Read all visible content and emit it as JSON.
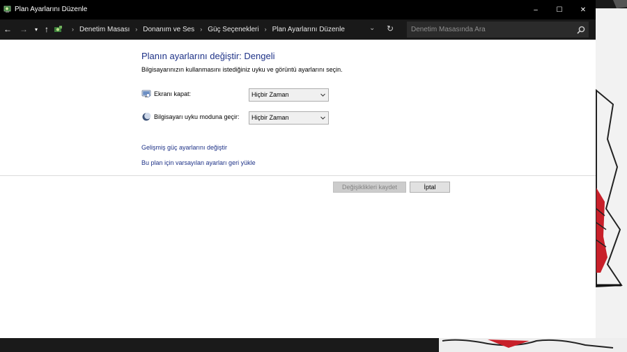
{
  "window": {
    "title": "Plan Ayarlarını Düzenle",
    "controls": {
      "minimize": "–",
      "maximize": "☐",
      "close": "✕"
    }
  },
  "addressbar": {
    "breadcrumbs": [
      "Denetim Masası",
      "Donanım ve Ses",
      "Güç Seçenekleri",
      "Plan Ayarlarını Düzenle"
    ],
    "search_placeholder": "Denetim Masasında Ara"
  },
  "content": {
    "heading": "Planın ayarlarını değiştir: Dengeli",
    "subheading": "Bilgisayarınızın kullanmasını istediğiniz uyku ve görüntü ayarlarını seçin.",
    "settings": [
      {
        "label": "Ekranı kapat:",
        "value": "Hiçbir Zaman",
        "icon": "monitor-icon"
      },
      {
        "label": "Bilgisayarı uyku moduna geçir:",
        "value": "Hiçbir Zaman",
        "icon": "moon-icon"
      }
    ],
    "links": {
      "advanced": "Gelişmiş güç ayarlarını değiştir",
      "restore": "Bu plan için varsayılan ayarları geri yükle"
    },
    "buttons": {
      "save": "Değişiklikleri kaydet",
      "cancel": "İptal"
    }
  },
  "colors": {
    "heading": "#1e3287",
    "titlebar": "#000000",
    "addressbar": "#191919"
  }
}
